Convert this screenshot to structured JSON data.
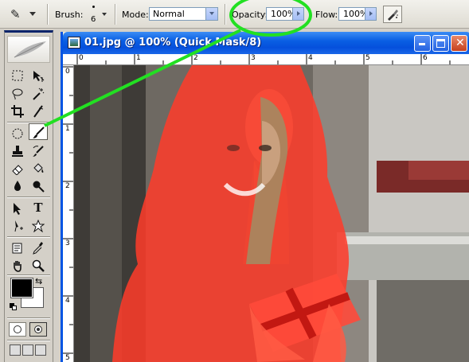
{
  "options_bar": {
    "brush_label": "Brush:",
    "brush_size": "6",
    "mode_label": "Mode:",
    "mode_value": "Normal",
    "opacity_label": "Opacity:",
    "opacity_value": "100%",
    "flow_label": "Flow:",
    "flow_value": "100%"
  },
  "document": {
    "title": "01.jpg @ 100% (Quick Mask/8)",
    "ruler_top_labels": [
      "0",
      "1",
      "2",
      "3",
      "4",
      "5",
      "6"
    ],
    "ruler_left_labels": [
      "0",
      "1",
      "2",
      "3",
      "4",
      "5"
    ]
  },
  "toolbox": {
    "tools": [
      "rect-marquee-icon",
      "move-icon",
      "lasso-icon",
      "magic-wand-icon",
      "crop-icon",
      "slice-icon",
      "healing-brush-icon",
      "brush-icon",
      "clone-stamp-icon",
      "history-brush-icon",
      "eraser-icon",
      "paint-bucket-icon",
      "blur-icon",
      "dodge-icon",
      "path-select-icon",
      "type-icon",
      "pen-icon",
      "custom-shape-icon",
      "notes-icon",
      "eyedropper-icon",
      "hand-icon",
      "zoom-icon"
    ],
    "foreground_color": "#000000",
    "background_color": "#ffffff"
  },
  "colors": {
    "quick_mask_overlay": "#ff3b2a",
    "annotation_highlight": "#22e022",
    "title_bar": "#0a5fe3"
  }
}
